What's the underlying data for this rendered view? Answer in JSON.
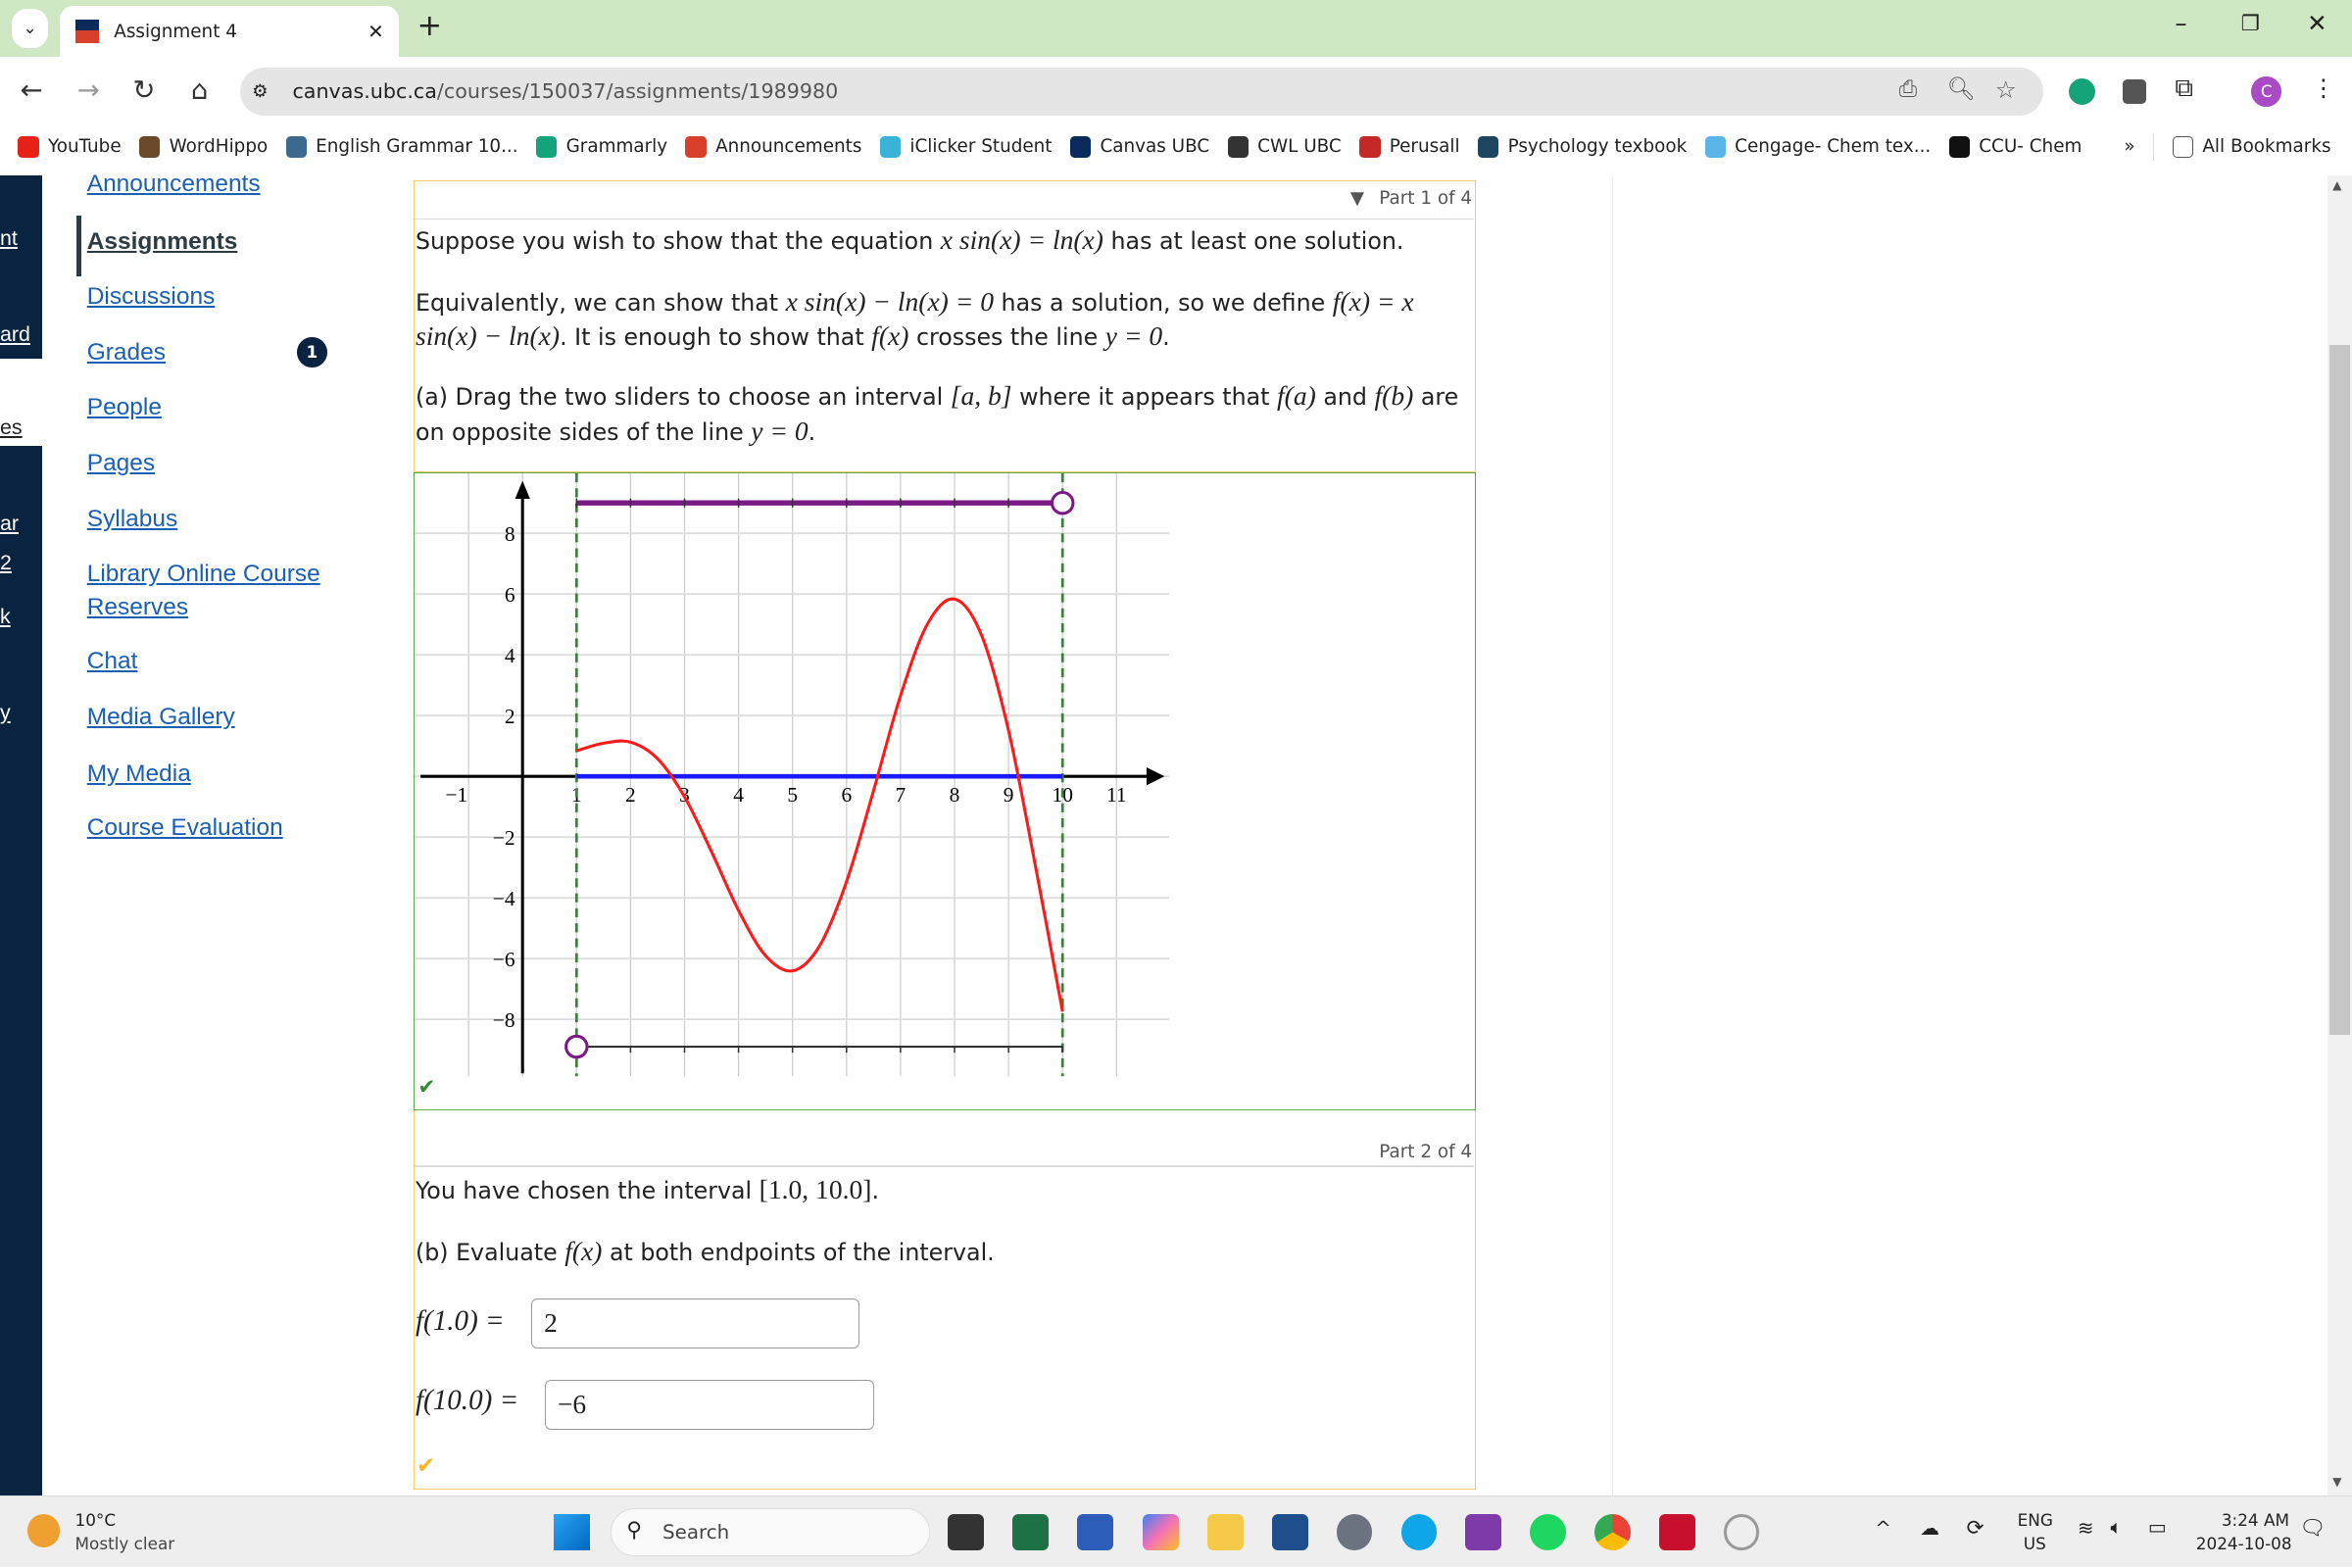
{
  "browser": {
    "tab_title": "Assignment 4",
    "url_host": "canvas.ubc.ca",
    "url_path": "/courses/150037/assignments/1989980",
    "profile_initial": "C",
    "bookmarks": [
      {
        "label": "YouTube",
        "color": "#e62117"
      },
      {
        "label": "WordHippo",
        "color": "#6b4a2b"
      },
      {
        "label": "English Grammar 10...",
        "color": "#3d6a8e"
      },
      {
        "label": "Grammarly",
        "color": "#15a37a"
      },
      {
        "label": "Announcements",
        "color": "#d9402b"
      },
      {
        "label": "iClicker Student",
        "color": "#3bb3d9"
      },
      {
        "label": "Canvas UBC",
        "color": "#0b2a5c"
      },
      {
        "label": "CWL UBC",
        "color": "#333333"
      },
      {
        "label": "Perusall",
        "color": "#c62828"
      },
      {
        "label": "Psychology texbook",
        "color": "#1d4560"
      },
      {
        "label": "Cengage- Chem tex...",
        "color": "#5ab4e8"
      },
      {
        "label": "CCU- Chem",
        "color": "#111111"
      }
    ],
    "more_bookmarks": "»",
    "all_bookmarks": "All Bookmarks"
  },
  "course_nav": {
    "items": [
      "Announcements",
      "Assignments",
      "Discussions",
      "Grades",
      "People",
      "Pages",
      "Syllabus",
      "Library Online Course Reserves",
      "Chat",
      "Media Gallery",
      "My Media",
      "Course Evaluation"
    ],
    "active": "Assignments",
    "grades_badge": "1"
  },
  "left_nav_fragments": [
    "nt",
    "ard",
    "es",
    "ar",
    "2",
    "k",
    "y"
  ],
  "part1": {
    "header": "Part 1 of 4",
    "p1a": "Suppose you wish to show that the equation ",
    "p1m": "x sin(x) = ln(x)",
    "p1b": " has at least one solution.",
    "p2a": "Equivalently, we can show that ",
    "p2m": "x sin(x) − ln(x) = 0",
    "p2b": " has a solution, so we define ",
    "p2m2": "f(x) = x sin(x) − ln(x)",
    "p2c": ". It is enough to show that ",
    "p2m3": "f(x)",
    "p2d": " crosses the line ",
    "p2m4": "y = 0",
    "p2e": ".",
    "p3a": "(a) Drag the two sliders to choose an interval ",
    "p3m": "[a, b]",
    "p3b": " where it appears that ",
    "p3m2": "f(a)",
    "p3c": " and ",
    "p3m3": "f(b)",
    "p3d": " are on opposite sides of the line ",
    "p3m4": "y = 0",
    "p3e": ".",
    "status": "correct"
  },
  "chart_data": {
    "type": "line",
    "xlim": [
      -1.9,
      12
    ],
    "ylim": [
      -9.9,
      9.9
    ],
    "xticks": [
      -1,
      1,
      2,
      3,
      4,
      5,
      6,
      7,
      8,
      9,
      10,
      11
    ],
    "yticks": [
      -8,
      -6,
      -4,
      -2,
      2,
      4,
      6,
      8
    ],
    "grid": true,
    "series": [
      {
        "color": "#ff1a1a",
        "x": [
          1,
          1.5,
          2,
          2.5,
          3,
          3.5,
          4,
          4.5,
          5,
          5.5,
          6,
          6.5,
          7,
          7.5,
          8,
          8.5,
          9,
          9.5,
          10
        ],
        "y": [
          0.841,
          1.091,
          1.125,
          0.58,
          -0.675,
          -2.481,
          -4.413,
          -5.903,
          -6.404,
          -5.585,
          -3.468,
          -0.474,
          2.653,
          5.02,
          5.836,
          4.647,
          1.512,
          -2.965,
          -7.743
        ]
      }
    ],
    "interval": {
      "a": 1.0,
      "b": 10.0,
      "interval_color": "#1a1aff",
      "dashed_color": "#2e8b2e"
    },
    "sliders": [
      {
        "name": "b",
        "value": 10.0,
        "color": "#7a1a86"
      },
      {
        "name": "a",
        "value": 1.0,
        "color": "#222222"
      }
    ]
  },
  "part2": {
    "header": "Part 2 of 4",
    "q1a": "You have chosen the interval ",
    "q1m": "[1.0, 10.0]",
    "q1b": ".",
    "q2a": "(b) Evaluate ",
    "q2m": "f(x)",
    "q2b": " at both endpoints of the interval.",
    "label_a": "f(1.0) =",
    "value_a": "2",
    "label_b": "f(10.0) =",
    "value_b": "−6",
    "status": "partially-correct"
  },
  "taskbar": {
    "weather_temp": "10°C",
    "weather_desc": "Mostly clear",
    "search": "Search",
    "lang1": "ENG",
    "lang2": "US",
    "time": "3:24 AM",
    "date": "2024-10-08"
  }
}
